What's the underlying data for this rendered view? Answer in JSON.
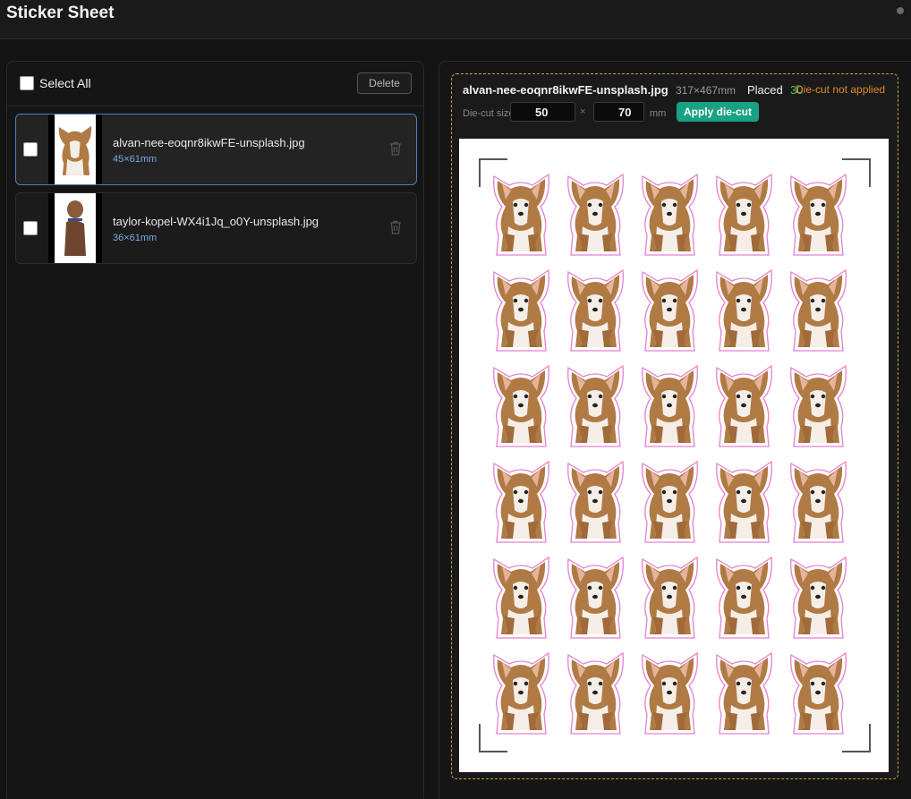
{
  "app": {
    "title": "Sticker Sheet"
  },
  "list": {
    "select_all_label": "Select All",
    "delete_label": "Delete",
    "files": [
      {
        "name": "alvan-nee-eoqnr8ikwFE-unsplash.jpg",
        "size": "45×61mm",
        "selected": true
      },
      {
        "name": "taylor-kopel-WX4i1Jq_o0Y-unsplash.jpg",
        "size": "36×61mm",
        "selected": false
      }
    ]
  },
  "workspace": {
    "selected_file": "alvan-nee-eoqnr8ikwFE-unsplash.jpg",
    "dimensions": "317×467mm",
    "placed_label": "Placed",
    "placed_count": "30",
    "diecut_status": "Die-cut not applied",
    "diecut_size_label": "Die-cut size",
    "diecut_width": "50",
    "diecut_x": "×",
    "diecut_height": "70",
    "diecut_unit": "mm",
    "apply_label": "Apply die-cut"
  },
  "colors": {
    "accent": "#19a184",
    "selection_border": "#4a7fc1",
    "warning": "#d98a2b",
    "success": "#4cc05e",
    "sticker_outline": "#e67fd0"
  }
}
